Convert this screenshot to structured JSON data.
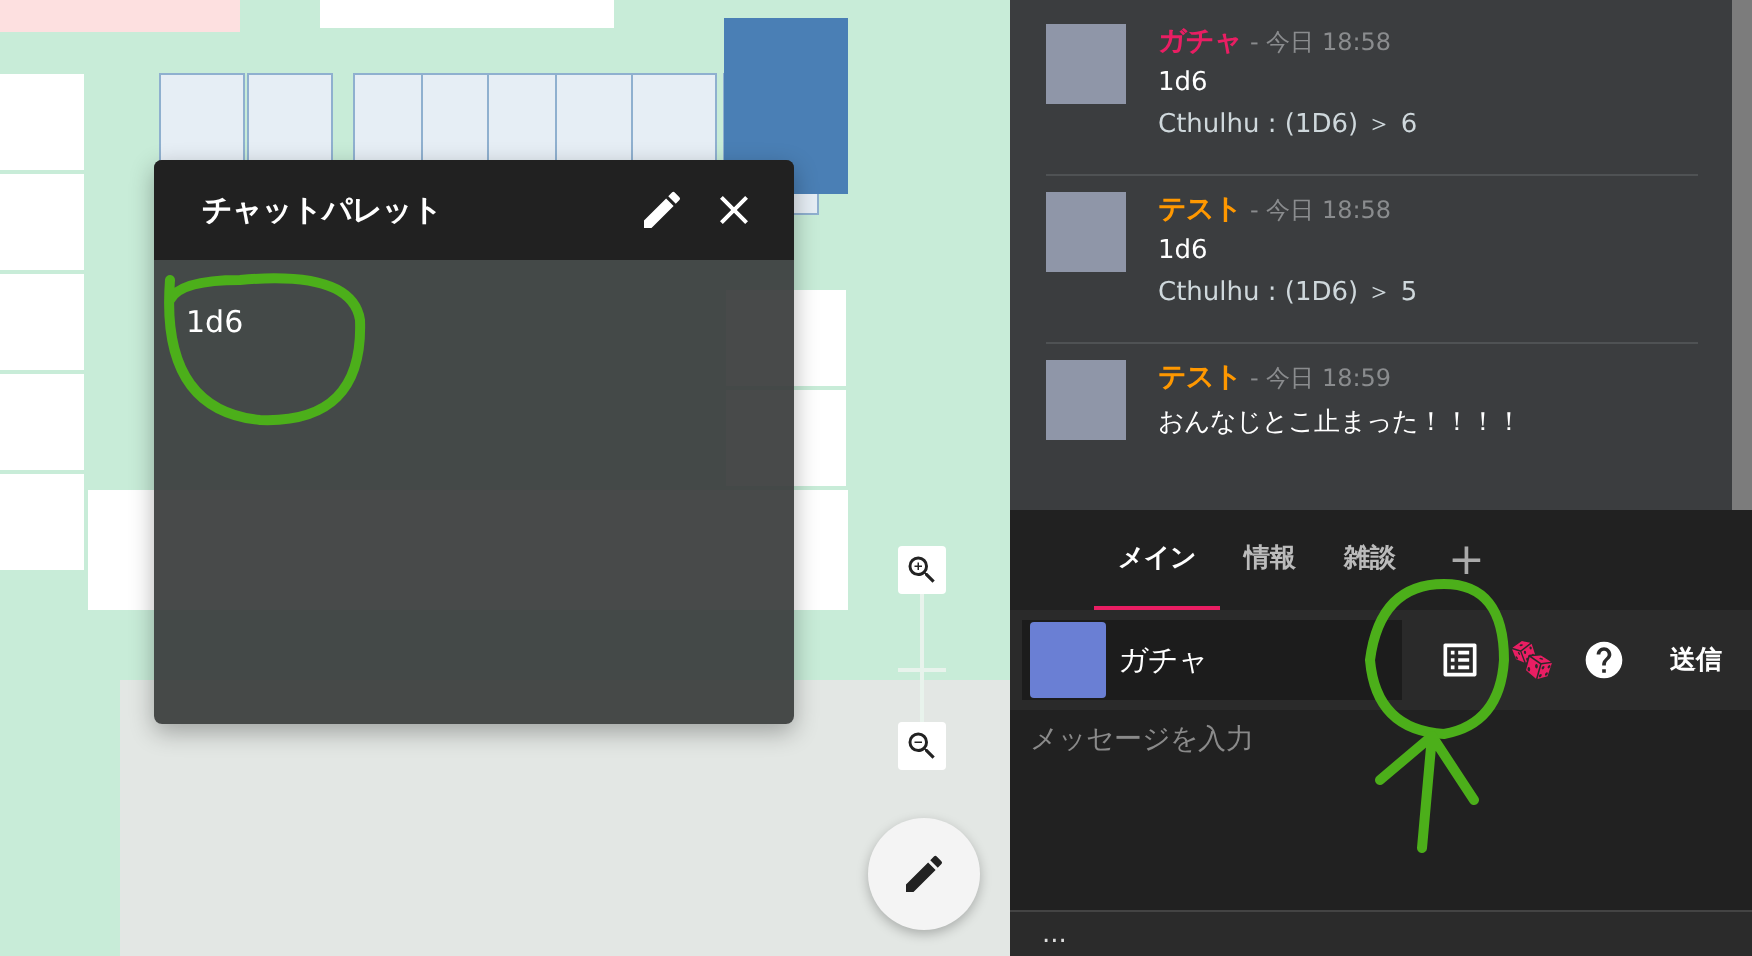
{
  "palette": {
    "title": "チャットパレット",
    "items": [
      "1d6"
    ]
  },
  "chat": {
    "messages": [
      {
        "name": "ガチャ",
        "color": "#e91e63",
        "time": "- 今日 18:58",
        "lines": [
          "1d6",
          "Cthulhu : (1D6) ＞ 6"
        ]
      },
      {
        "name": "テスト",
        "color": "#ff9800",
        "time": "- 今日 18:58",
        "lines": [
          "1d6",
          "Cthulhu : (1D6) ＞ 5"
        ]
      },
      {
        "name": "テスト",
        "color": "#ff9800",
        "time": "- 今日 18:59",
        "lines": [
          "おんなじとこ止まった！！！！"
        ]
      }
    ]
  },
  "tabs": [
    {
      "label": "メイン",
      "selected": true
    },
    {
      "label": "情報",
      "selected": false
    },
    {
      "label": "雑談",
      "selected": false
    }
  ],
  "add_tab": "+",
  "composer": {
    "character": "ガチャ",
    "placeholder": "メッセージを入力",
    "send": "送信"
  },
  "footer": "..."
}
